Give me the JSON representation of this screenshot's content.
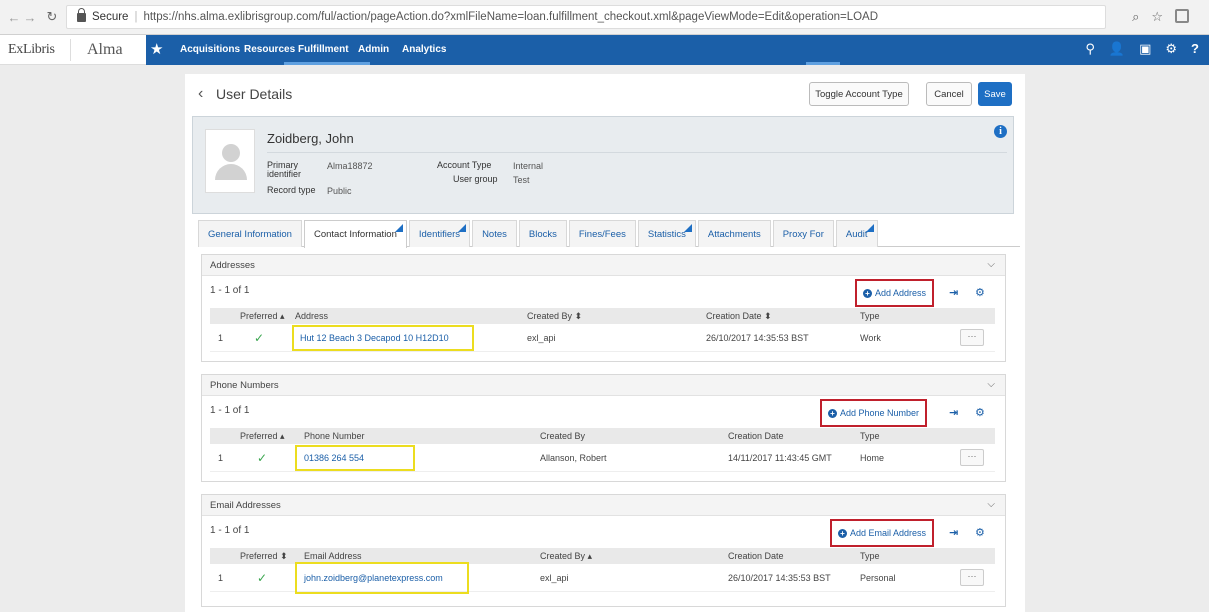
{
  "browser": {
    "secure_label": "Secure",
    "url": "https://nhs.alma.exlibrisgroup.com/ful/action/pageAction.do?xmlFileName=loan.fulfillment_checkout.xml&pageViewMode=Edit&operation=LOAD"
  },
  "header": {
    "brand": "ExLibris",
    "app_name": "Alma",
    "nav": [
      "Acquisitions",
      "Resources",
      "Fulfillment",
      "Admin",
      "Analytics"
    ],
    "right_icons": [
      "location-icon",
      "user-icon",
      "clipboard-icon",
      "gear-icon",
      "help-icon"
    ]
  },
  "page": {
    "title": "User Details",
    "toggle_label": "Toggle Account Type",
    "cancel_label": "Cancel",
    "save_label": "Save"
  },
  "user": {
    "name": "Zoidberg, John",
    "primary_identifier_label": "Primary identifier",
    "primary_identifier": "Alma18872",
    "record_type_label": "Record type",
    "record_type": "Public",
    "account_type_label": "Account Type",
    "account_type": "Internal",
    "user_group_label": "User group",
    "user_group": "Test"
  },
  "tabs": [
    "General Information",
    "Contact Information",
    "Identifiers",
    "Notes",
    "Blocks",
    "Fines/Fees",
    "Statistics",
    "Attachments",
    "Proxy For",
    "Audit"
  ],
  "addresses": {
    "title": "Addresses",
    "count": "1 - 1 of 1",
    "add_label": "Add Address",
    "columns": [
      "Preferred ▴",
      "Address",
      "Created By ⬍",
      "Creation Date ⬍",
      "Type"
    ],
    "row": {
      "index": "1",
      "value": "Hut 12 Beach 3 Decapod 10 H12D10",
      "created_by": "exl_api",
      "date": "26/10/2017 14:35:53 BST",
      "type": "Work"
    }
  },
  "phones": {
    "title": "Phone Numbers",
    "count": "1 - 1 of 1",
    "add_label": "Add Phone Number",
    "columns": [
      "Preferred ▴",
      "Phone Number",
      "Created By",
      "Creation Date",
      "Type"
    ],
    "row": {
      "index": "1",
      "value": "01386 264 554",
      "created_by": "Allanson, Robert",
      "date": "14/11/2017 11:43:45 GMT",
      "type": "Home"
    }
  },
  "emails": {
    "title": "Email Addresses",
    "count": "1 - 1 of 1",
    "add_label": "Add Email Address",
    "columns": [
      "Preferred ⬍",
      "Email Address",
      "Created By ▴",
      "Creation Date",
      "Type"
    ],
    "row": {
      "index": "1",
      "value": "john.zoidberg@planetexpress.com",
      "created_by": "exl_api",
      "date": "26/10/2017 14:35:53 BST",
      "type": "Personal"
    }
  },
  "colors": {
    "accent": "#1b5fa8",
    "highlight_red": "#c0202c",
    "highlight_yellow": "#ecdd1f"
  }
}
